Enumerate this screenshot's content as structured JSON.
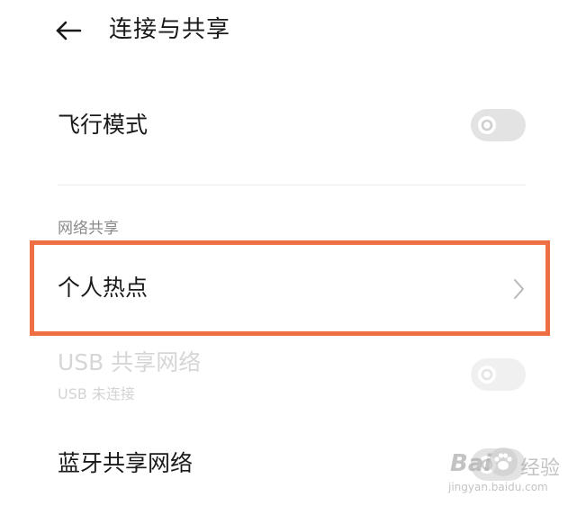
{
  "header": {
    "title": "连接与共享",
    "back_icon": "arrow-left-icon"
  },
  "airplane": {
    "label": "飞行模式",
    "toggle_state": "off"
  },
  "network_sharing": {
    "section_label": "网络共享",
    "hotspot": {
      "label": "个人热点",
      "icon": "chevron-right-icon"
    },
    "usb": {
      "label": "USB 共享网络",
      "sublabel": "USB 未连接",
      "toggle_state": "off",
      "enabled": false
    },
    "bluetooth": {
      "label": "蓝牙共享网络",
      "toggle_state": "off"
    }
  },
  "annotation": {
    "highlight_color": "#ee6f43"
  },
  "watermark": {
    "brand": "Bai",
    "brand_suffix": "经验",
    "domain": "jingyan.baidu.com",
    "icon": "paw-icon"
  }
}
